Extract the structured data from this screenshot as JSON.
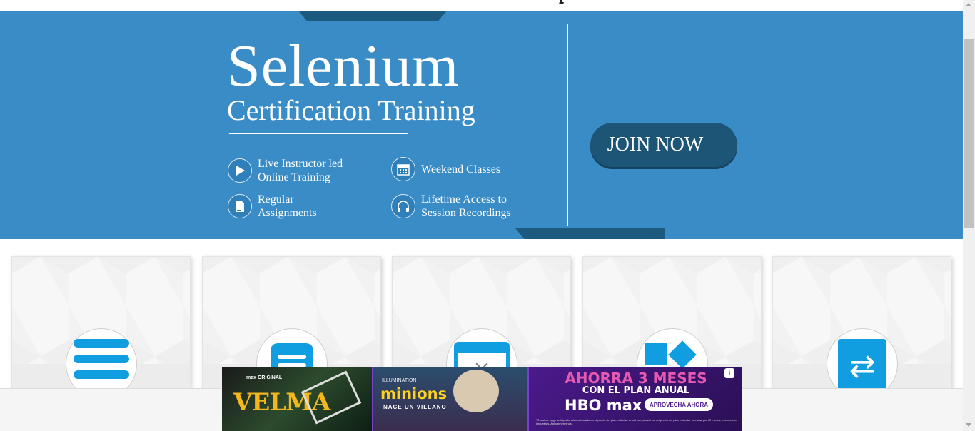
{
  "banner": {
    "title": "Selenium",
    "subtitle": "Certification Training",
    "features": [
      {
        "icon": "play-icon",
        "text": "Live Instructor led\nOnline Training"
      },
      {
        "icon": "calendar-icon",
        "text": "Weekend Classes"
      },
      {
        "icon": "document-icon",
        "text": "Regular\nAssignments"
      },
      {
        "icon": "headphones-icon",
        "text": "Lifetime Access to\nSession Recordings"
      }
    ],
    "cta_label": "JOIN NOW",
    "background_color": "#3a8cc6",
    "accent_color": "#1d5577"
  },
  "cards": [
    {
      "icon": "menu-icon"
    },
    {
      "icon": "document-icon"
    },
    {
      "icon": "browser-window-icon"
    },
    {
      "icon": "shapes-icon"
    },
    {
      "icon": "sync-icon"
    }
  ],
  "icon_color": "#109ee0",
  "ad": {
    "panel1": {
      "brand": "max ORIGINAL",
      "show": "VELMA"
    },
    "panel2": {
      "brand": "ILLUMINATION",
      "movie": "minions",
      "tagline": "NACE UN VILLANO"
    },
    "panel3": {
      "headline": "AHORRA 3 MESES",
      "subline": "CON EL PLAN ANUAL",
      "logo": "HBO max",
      "cta": "APROVECHA AHORA",
      "fineprint": "*Requiere pago anticipado. Ahorro basado en el precio del plan estándar anual comparado con el precio del plan estándar mensual por 12 meses, excluyendo impuestos. Aplican términos."
    },
    "info_icon": "info-icon"
  }
}
